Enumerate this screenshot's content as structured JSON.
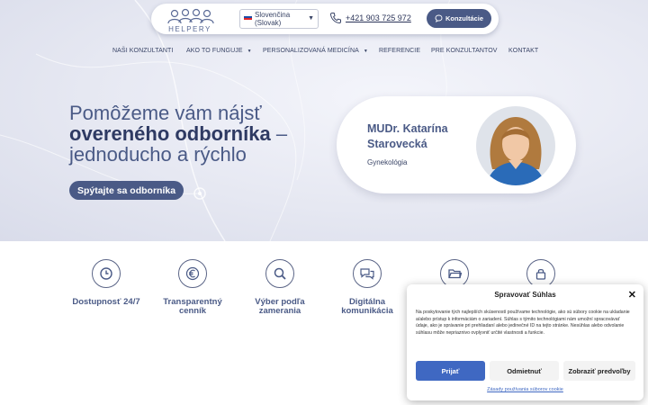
{
  "header": {
    "logo_text": "HELPERY",
    "language": "Slovenčina (Slovak)",
    "phone": "+421 903 725 972",
    "consult_button": "Konzultácie"
  },
  "nav": {
    "items": [
      {
        "label": "NAŠI KONZULTANTI",
        "dropdown": false
      },
      {
        "label": "AKO TO FUNGUJE",
        "dropdown": true
      },
      {
        "label": "PERSONALIZOVANÁ MEDICÍNA",
        "dropdown": true
      },
      {
        "label": "REFERENCIE",
        "dropdown": false
      },
      {
        "label": "PRE KONZULTANTOV",
        "dropdown": false
      },
      {
        "label": "KONTAKT",
        "dropdown": false
      }
    ]
  },
  "hero": {
    "line1": "Pomôžeme vám nájsť",
    "line2_bold": "overeného odborníka",
    "line2_rest": " –",
    "line3": "jednoducho a rýchlo",
    "cta": "Spýtajte sa odborníka"
  },
  "doctor": {
    "name": "MUDr. Katarína Starovecká",
    "specialty": "Gynekológia"
  },
  "features": [
    {
      "icon": "clock-icon",
      "label": "Dostupnosť 24/7"
    },
    {
      "icon": "euro-icon",
      "label": "Transparentný cenník"
    },
    {
      "icon": "search-icon",
      "label": "Výber podľa zamerania"
    },
    {
      "icon": "chat-icon",
      "label": "Digitálna komunikácia"
    },
    {
      "icon": "folder-icon",
      "label": ""
    },
    {
      "icon": "lock-icon",
      "label": ""
    }
  ],
  "cookie_modal": {
    "title": "Spravovať Súhlas",
    "text": "Na poskytovanie tých najlepších skúseností používame technológie, ako sú súbory cookie na ukladanie a/alebo prístup k informáciám o zariadení. Súhlas s týmito technológiami nám umožní spracovávať údaje, ako je správanie pri prehliadaní alebo jedinečné ID na tejto stránke. Nesúhlas alebo odvolanie súhlasu môže nepriaznivo ovplyvniť určité vlastnosti a funkcie.",
    "accept": "Prijať",
    "deny": "Odmietnuť",
    "preferences": "Zobraziť predvoľby",
    "policy_link": "Zásady používania súborov cookie"
  },
  "colors": {
    "primary": "#4a5a86",
    "dark_navy": "#2e3a63",
    "accept_blue": "#3f68c2"
  }
}
